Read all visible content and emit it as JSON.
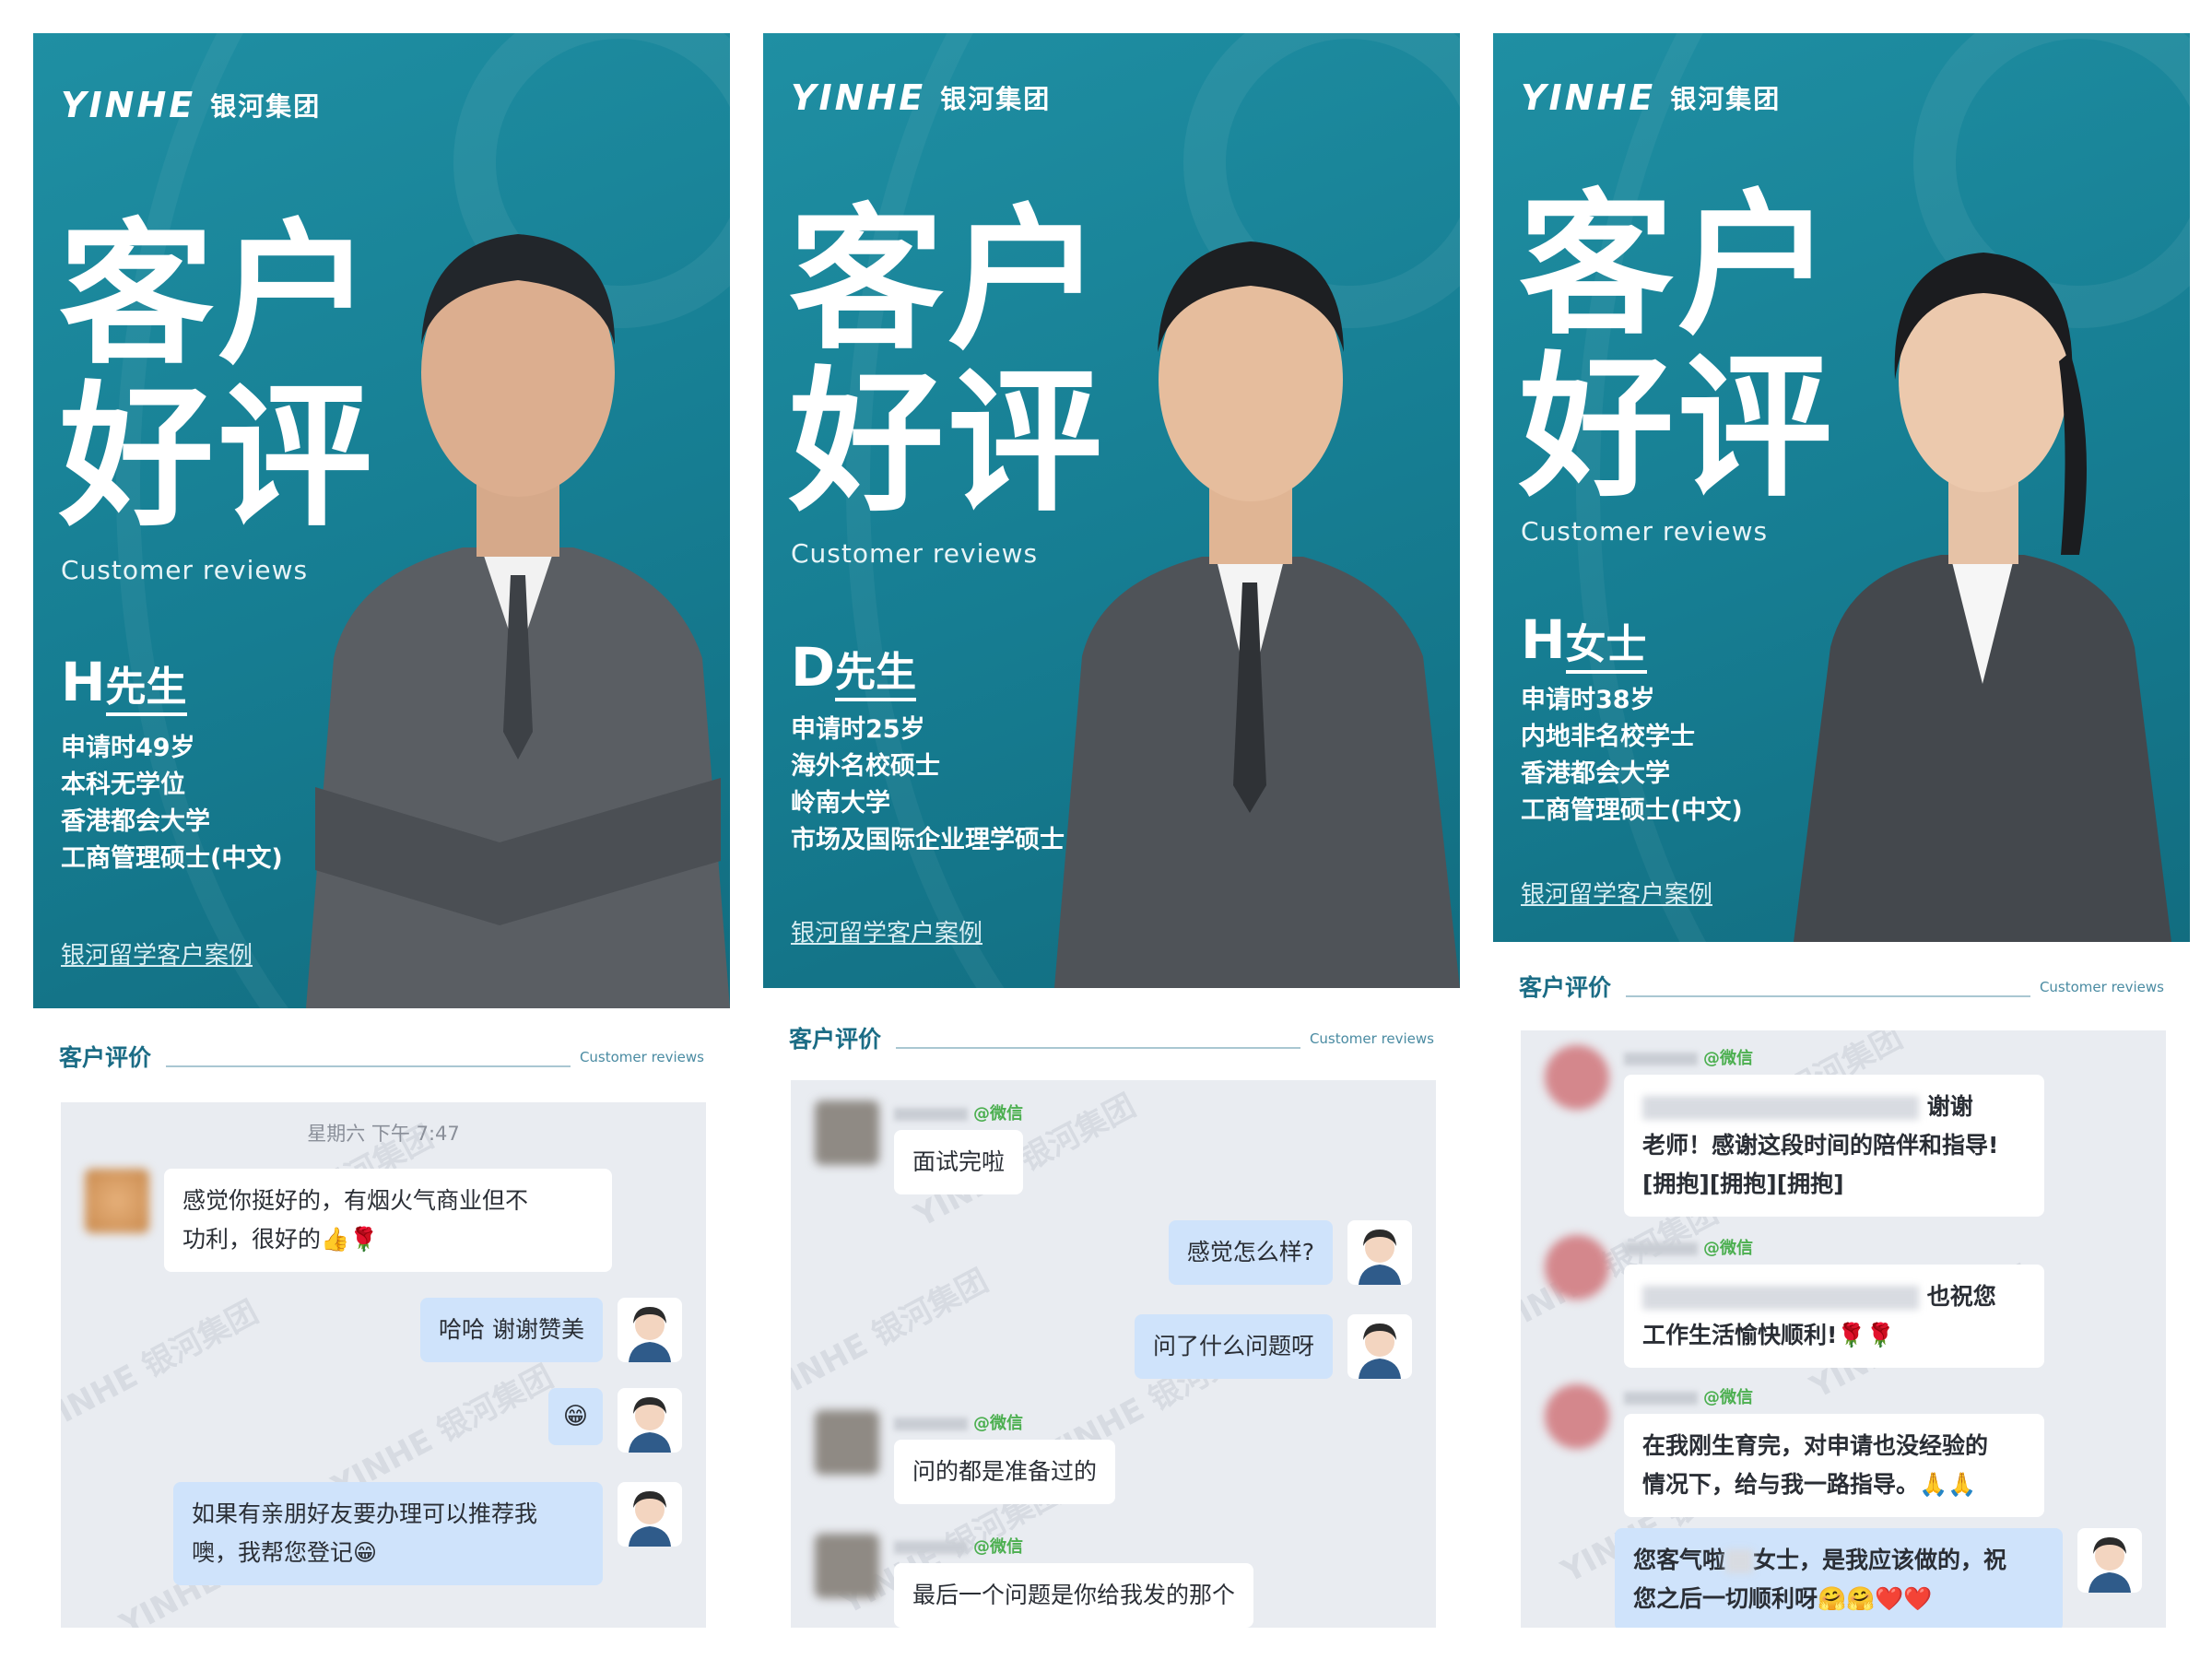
{
  "brand": {
    "logo_mark": "YINHE",
    "logo_cn": "银河集团"
  },
  "posters": [
    {
      "title_line1": "客户",
      "title_line2": "好评",
      "subtitle": "Customer reviews",
      "client_surname": "H",
      "client_title": "先生",
      "details": [
        "申请时49岁",
        "本科无学位",
        "香港都会大学",
        "工商管理硕士(中文)"
      ],
      "case_link": "银河留学客户案例"
    },
    {
      "title_line1": "客户",
      "title_line2": "好评",
      "subtitle": "Customer reviews",
      "client_surname": "D",
      "client_title": "先生",
      "details": [
        "申请时25岁",
        "海外名校硕士",
        "岭南大学",
        "市场及国际企业理学硕士"
      ],
      "case_link": "银河留学客户案例"
    },
    {
      "title_line1": "客户",
      "title_line2": "好评",
      "subtitle": "Customer reviews",
      "client_surname": "H",
      "client_title": "女士",
      "details": [
        "申请时38岁",
        "内地非名校学士",
        "香港都会大学",
        "工商管理硕士(中文)"
      ],
      "case_link": "银河留学客户案例"
    }
  ],
  "review_section": {
    "title": "客户评价",
    "title_en": "Customer reviews"
  },
  "chat1": {
    "timestamp": "星期六 下午 7:47",
    "messages": [
      {
        "text_a": "感觉你挺好的，有烟火气商业但不",
        "text_b": "功利，很好的👍🌹"
      },
      {
        "text": "哈哈  谢谢赞美"
      },
      {
        "text": "😁"
      },
      {
        "text_a": "如果有亲朋好友要办理可以推荐我",
        "text_b": "噢，我帮您登记😁"
      }
    ]
  },
  "chat2": {
    "sender_tag": "@微信",
    "messages": [
      {
        "text": "面试完啦"
      },
      {
        "text": "感觉怎么样?"
      },
      {
        "text": "问了什么问题呀"
      },
      {
        "text": "问的都是准备过的"
      },
      {
        "text": "最后一个问题是你给我发的那个"
      }
    ]
  },
  "chat3": {
    "sender_tag": "@微信",
    "messages": [
      {
        "tail": "谢谢",
        "line2": "老师！感谢这段时间的陪伴和指导!",
        "line3": "[拥抱][拥抱][拥抱]"
      },
      {
        "tail": "也祝您",
        "line2": "工作生活愉快顺利!🌹🌹"
      },
      {
        "line1": "在我刚生育完，对申请也没经验的",
        "line2": "情况下，给与我一路指导。🙏🙏"
      },
      {
        "line1_a": "您客气啦",
        "line1_b": "女士，是我应该做的，祝",
        "line2": "您之后一切顺利呀🤗🤗❤️❤️"
      }
    ]
  },
  "colors": {
    "poster_teal": "#1a8499",
    "bubble_out": "#cfe3fb",
    "chat_bg": "#e9ecf1",
    "wechat_green": "#4caf50"
  }
}
